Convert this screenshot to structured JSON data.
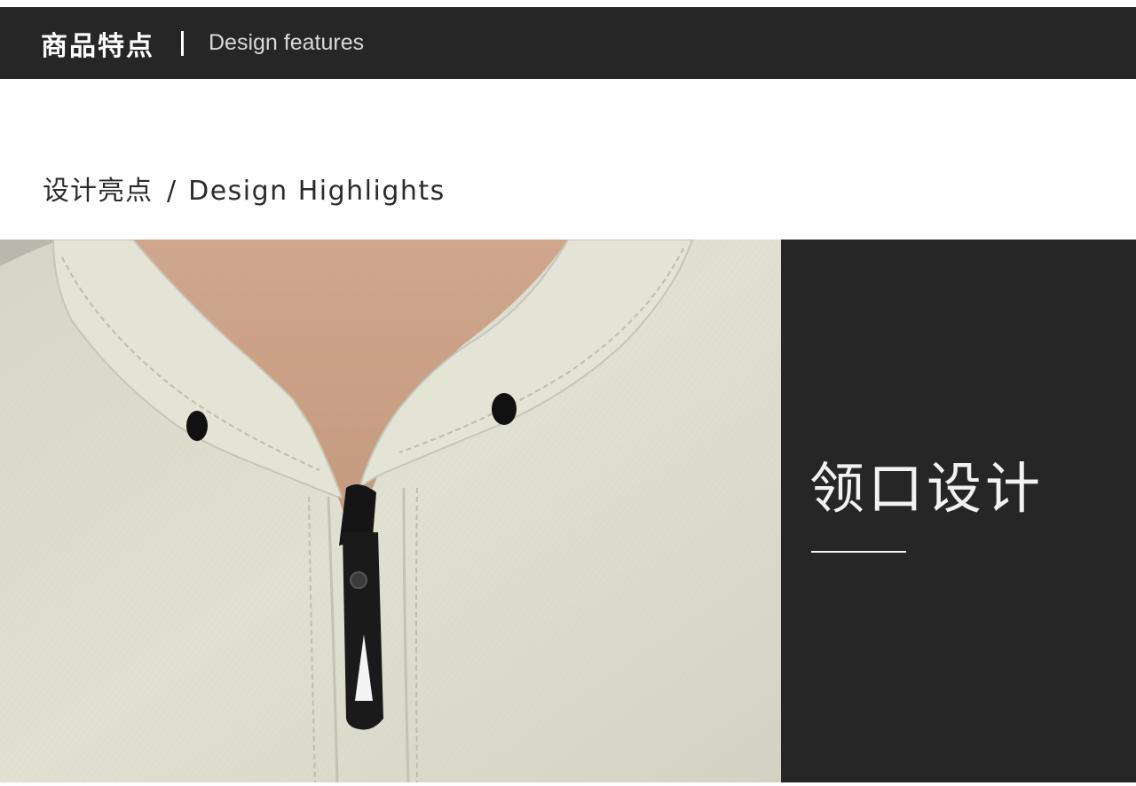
{
  "header": {
    "title_zh": "商品特点",
    "title_en": "Design features"
  },
  "section": {
    "title_zh": "设计亮点",
    "separator": "/",
    "title_en": "Design Highlights"
  },
  "feature_panel": {
    "title": "领口设计"
  },
  "colors": {
    "dark": "#262626",
    "fabric": "#dcdcd0",
    "skin": "#d8b49a"
  }
}
